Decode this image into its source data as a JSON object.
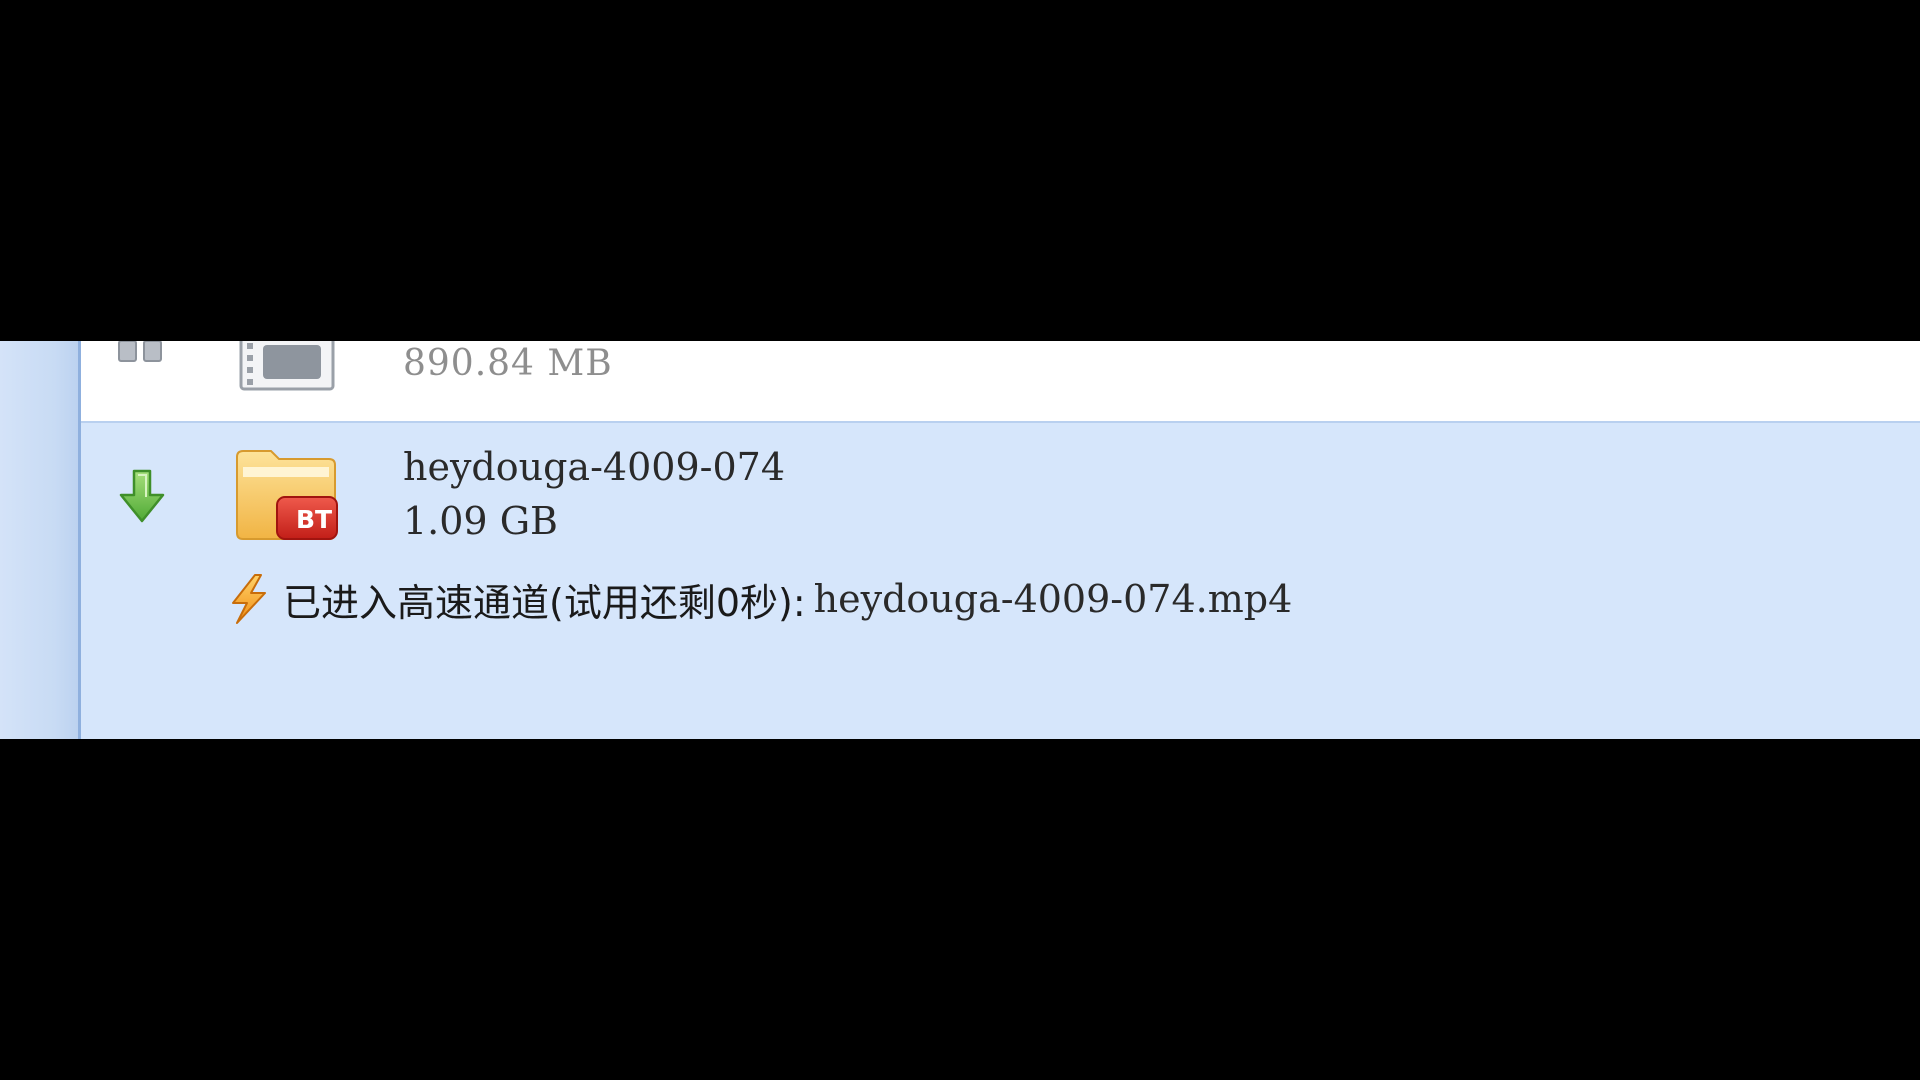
{
  "tasks": [
    {
      "state": "paused",
      "icon": "video-file-icon",
      "size": "890.84 MB"
    },
    {
      "state": "downloading",
      "icon": "bt-folder-icon",
      "name": "heydouga-4009-074",
      "size": "1.09 GB",
      "badge": "BT",
      "turbo": {
        "prefix": "已进入高速通道(试用还剩0秒):",
        "file": "heydouga-4009-074.mp4"
      }
    }
  ],
  "colors": {
    "selected_row": "#d6e6fb",
    "sidebar": "#c8dbf4",
    "download_arrow": "#6cc24a",
    "folder": "#f7c45a",
    "bt_badge": "#d9302a",
    "lightning": "#f2a51e"
  }
}
